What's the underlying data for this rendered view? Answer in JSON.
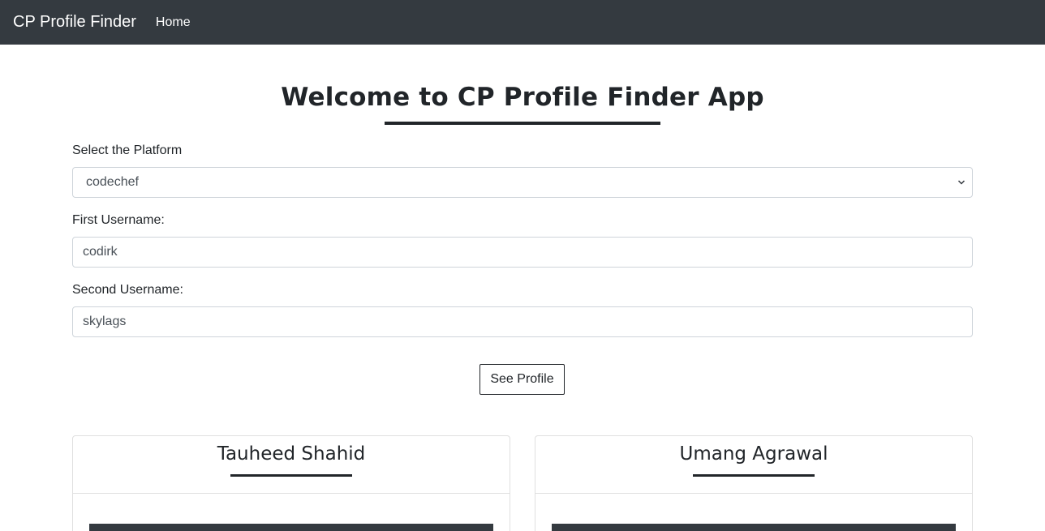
{
  "navbar": {
    "brand": "CP Profile Finder",
    "links": [
      "Home"
    ]
  },
  "main": {
    "title": "Welcome to CP Profile Finder App",
    "platform": {
      "label": "Select the Platform",
      "selected": "codechef"
    },
    "first_username": {
      "label": "First Username:",
      "value": "codirk"
    },
    "second_username": {
      "label": "Second Username:",
      "value": "skylags"
    },
    "submit_label": "See Profile"
  },
  "profiles": [
    {
      "name": "Tauheed Shahid"
    },
    {
      "name": "Umang Agrawal"
    }
  ],
  "colors": {
    "navbar": "#343a40",
    "text": "#212529",
    "border": "#ced4da"
  }
}
